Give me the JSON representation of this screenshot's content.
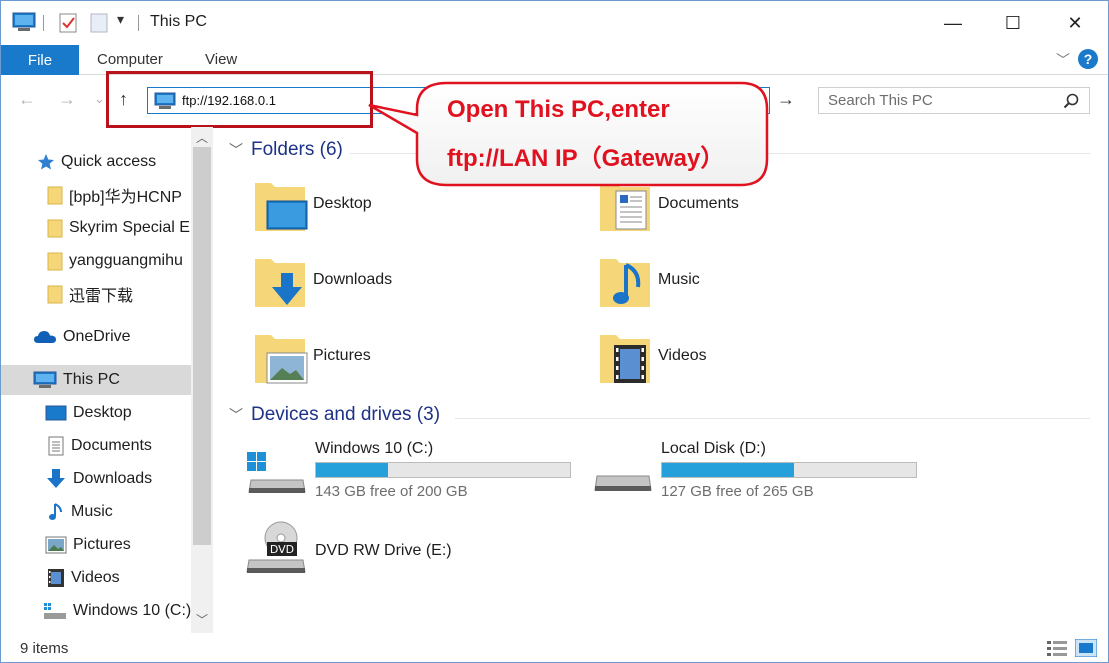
{
  "window": {
    "title": "This PC",
    "controls": {
      "minimize": "—",
      "maximize": "☐",
      "close": "✕"
    }
  },
  "ribbon": {
    "tabs": [
      "File",
      "Computer",
      "View"
    ],
    "chevron": "﹀",
    "help": "?"
  },
  "nav": {
    "back": "←",
    "forward": "→",
    "recent": "⌄",
    "up": "↑",
    "address": "ftp://192.168.0.1",
    "go": "→",
    "search_placeholder": "Search This PC"
  },
  "sidebar": {
    "items": [
      {
        "label": "Quick access",
        "icon": "star-icon"
      },
      {
        "label": "[bpb]华为HCNP",
        "icon": "folder-icon"
      },
      {
        "label": "Skyrim Special E",
        "icon": "folder-icon"
      },
      {
        "label": "yangguangmihu",
        "icon": "folder-icon"
      },
      {
        "label": "迅雷下载",
        "icon": "folder-icon"
      },
      {
        "label": "OneDrive",
        "icon": "cloud-icon"
      },
      {
        "label": "This PC",
        "icon": "computer-icon",
        "selected": true
      },
      {
        "label": "Desktop",
        "icon": "desktop-icon"
      },
      {
        "label": "Documents",
        "icon": "documents-icon"
      },
      {
        "label": "Downloads",
        "icon": "download-icon"
      },
      {
        "label": "Music",
        "icon": "music-icon"
      },
      {
        "label": "Pictures",
        "icon": "pictures-icon"
      },
      {
        "label": "Videos",
        "icon": "videos-icon"
      },
      {
        "label": "Windows 10 (C:)",
        "icon": "drive-icon"
      }
    ]
  },
  "folders": {
    "header": "Folders (6)",
    "items": [
      {
        "label": "Desktop",
        "icon": "desktop-folder-icon"
      },
      {
        "label": "Documents",
        "icon": "documents-folder-icon"
      },
      {
        "label": "Downloads",
        "icon": "downloads-folder-icon"
      },
      {
        "label": "Music",
        "icon": "music-folder-icon"
      },
      {
        "label": "Pictures",
        "icon": "pictures-folder-icon"
      },
      {
        "label": "Videos",
        "icon": "videos-folder-icon"
      }
    ]
  },
  "devices": {
    "header": "Devices and drives (3)",
    "items": [
      {
        "label": "Windows 10 (C:)",
        "free": "143 GB free of 200 GB",
        "used_fraction": 0.285,
        "icon": "windows-drive-icon"
      },
      {
        "label": "Local Disk (D:)",
        "free": "127 GB free of 265 GB",
        "used_fraction": 0.521,
        "icon": "local-disk-icon"
      },
      {
        "label": "DVD RW Drive (E:)",
        "icon": "dvd-drive-icon"
      }
    ]
  },
  "callout": {
    "line1": "Open This PC,enter",
    "line2": "ftp://LAN IP（Gateway）"
  },
  "status": {
    "items": "9 items"
  },
  "colors": {
    "accent": "#1979ca",
    "callout_red": "#e0121f",
    "highlight_red": "#b9121b",
    "bar_fill": "#26a0da",
    "section_text": "#1e3287"
  }
}
